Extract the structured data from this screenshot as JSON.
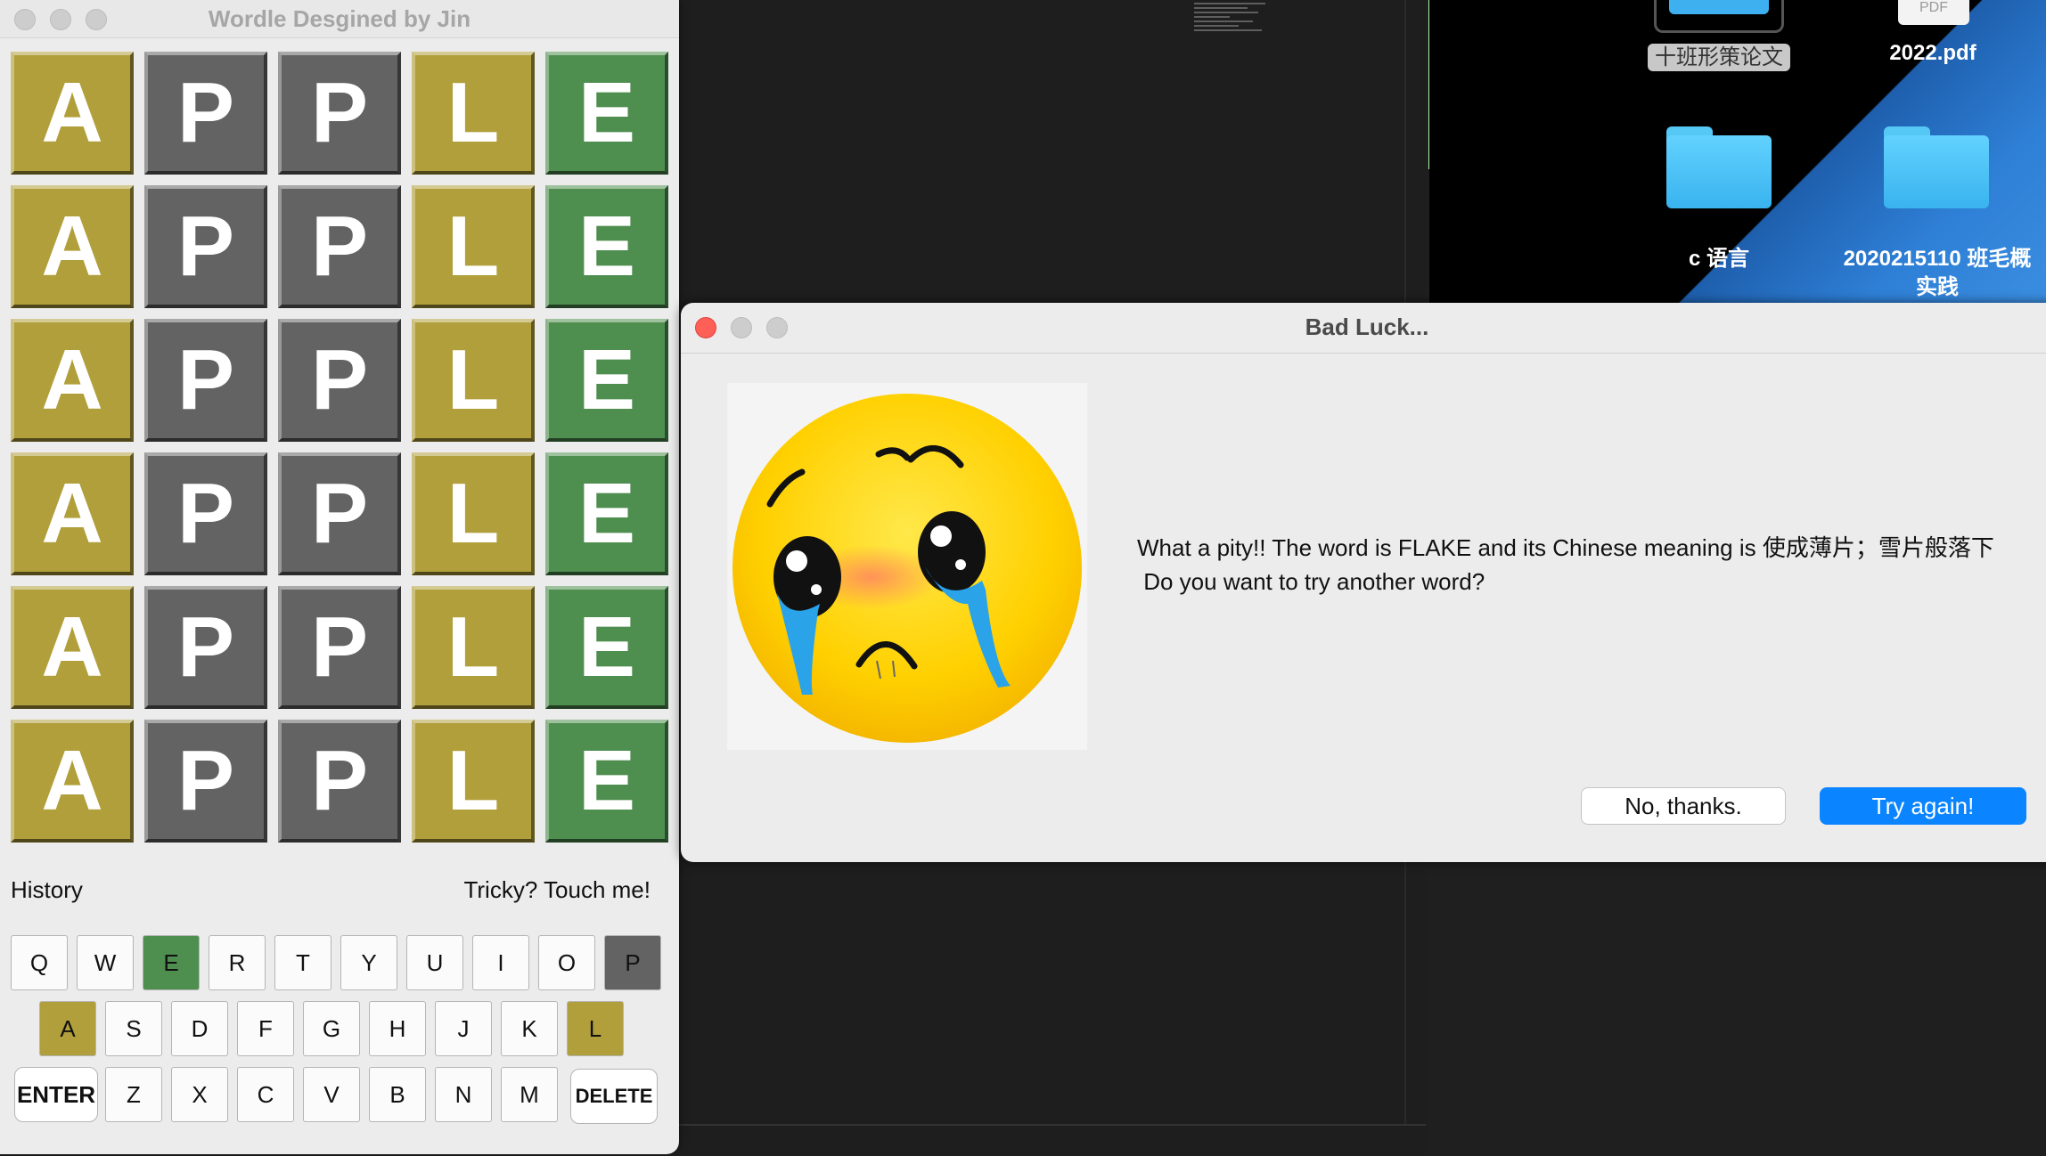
{
  "wordle": {
    "title": "Wordle Desgined by Jin",
    "guesses": [
      [
        "A",
        "P",
        "P",
        "L",
        "E"
      ],
      [
        "A",
        "P",
        "P",
        "L",
        "E"
      ],
      [
        "A",
        "P",
        "P",
        "L",
        "E"
      ],
      [
        "A",
        "P",
        "P",
        "L",
        "E"
      ],
      [
        "A",
        "P",
        "P",
        "L",
        "E"
      ],
      [
        "A",
        "P",
        "P",
        "L",
        "E"
      ]
    ],
    "tile_states": [
      "present",
      "absent",
      "absent",
      "present",
      "correct"
    ],
    "history_label": "History",
    "tricky_label": "Tricky? Touch me!",
    "keyboard": {
      "row1": [
        {
          "k": "Q",
          "s": ""
        },
        {
          "k": "W",
          "s": ""
        },
        {
          "k": "E",
          "s": "correct"
        },
        {
          "k": "R",
          "s": ""
        },
        {
          "k": "T",
          "s": ""
        },
        {
          "k": "Y",
          "s": ""
        },
        {
          "k": "U",
          "s": ""
        },
        {
          "k": "I",
          "s": ""
        },
        {
          "k": "O",
          "s": ""
        },
        {
          "k": "P",
          "s": "absent"
        }
      ],
      "row2": [
        {
          "k": "A",
          "s": "present"
        },
        {
          "k": "S",
          "s": ""
        },
        {
          "k": "D",
          "s": ""
        },
        {
          "k": "F",
          "s": ""
        },
        {
          "k": "G",
          "s": ""
        },
        {
          "k": "H",
          "s": ""
        },
        {
          "k": "J",
          "s": ""
        },
        {
          "k": "K",
          "s": ""
        },
        {
          "k": "L",
          "s": "present"
        }
      ],
      "row3": [
        {
          "k": "Z",
          "s": ""
        },
        {
          "k": "X",
          "s": ""
        },
        {
          "k": "C",
          "s": ""
        },
        {
          "k": "V",
          "s": ""
        },
        {
          "k": "B",
          "s": ""
        },
        {
          "k": "N",
          "s": ""
        },
        {
          "k": "M",
          "s": ""
        }
      ],
      "enter_label": "ENTER",
      "delete_label": "DELETE"
    },
    "colors": {
      "present": "#b19f3b",
      "absent": "#636363",
      "correct": "#4e8e4f"
    }
  },
  "dialog": {
    "title": "Bad Luck...",
    "message_line1": "What a pity!! The word is FLAKE and its Chinese meaning is 使成薄片；雪片般落下",
    "message_line2": " Do you want to try another word?",
    "no_label": "No, thanks.",
    "yes_label": "Try again!",
    "emoji_icon": "crying-face-icon"
  },
  "desktop": {
    "items": [
      {
        "label": "十班形策论文"
      },
      {
        "label": "2022.pdf"
      },
      {
        "label": "c 语言"
      },
      {
        "label": "2020215110 班毛概"
      },
      {
        "label": "实践"
      }
    ],
    "pdf_badge": "PDF"
  }
}
